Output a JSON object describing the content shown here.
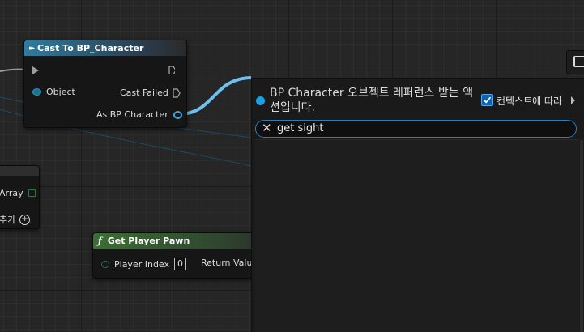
{
  "cast_node": {
    "title": "Cast To BP_Character",
    "object_pin": "Object",
    "cast_failed_pin": "Cast Failed",
    "as_pin": "As BP Character"
  },
  "left_node": {
    "array_pin": "Array",
    "add_pin": "추가"
  },
  "player_pawn_node": {
    "title": "Get Player Pawn",
    "player_index_label": "Player Index",
    "player_index_value": "0",
    "return_label": "Return Value"
  },
  "action_menu": {
    "title": "BP Character 오브젝트 레퍼런스 받는 액션입니다.",
    "context_label": "컨텍스트에 따라",
    "context_checked": true,
    "search_value": "get sight"
  },
  "colors": {
    "cast_header": "#2e7ca0",
    "pure_header": "#3c6e36",
    "object_wire": "#6ec0f0",
    "search_border": "#1f7fd0"
  }
}
